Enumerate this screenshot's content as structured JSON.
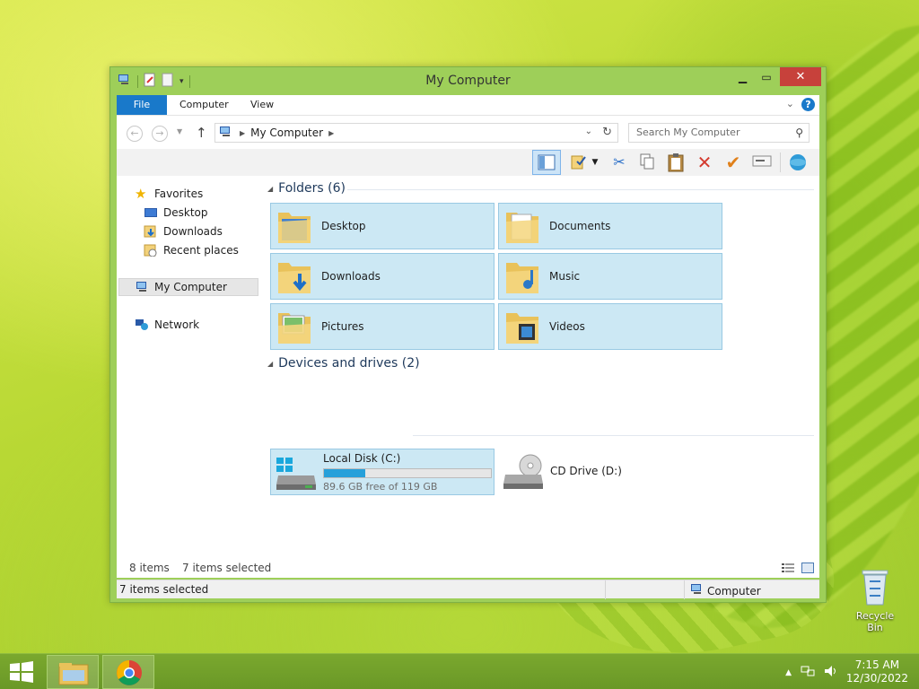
{
  "window": {
    "title": "My Computer"
  },
  "ribbon": {
    "tabs": [
      "File",
      "Computer",
      "View"
    ]
  },
  "address": {
    "crumb": "My Computer",
    "search_placeholder": "Search My Computer"
  },
  "nav_pane": {
    "favorites": "Favorites",
    "items": [
      "Desktop",
      "Downloads",
      "Recent places"
    ],
    "computer": "My Computer",
    "network": "Network"
  },
  "folders": {
    "header": "Folders (6)",
    "items": [
      "Desktop",
      "Documents",
      "Downloads",
      "Music",
      "Pictures",
      "Videos"
    ]
  },
  "drives": {
    "header": "Devices and drives (2)",
    "local": {
      "name": "Local Disk (C:)",
      "free_text": "89.6 GB free of 119 GB",
      "used_fraction": 0.247
    },
    "cd": {
      "name": "CD Drive (D:)"
    }
  },
  "status": {
    "count": "8 items",
    "selected": "7 items selected",
    "bar_left": "7 items selected",
    "bar_right": "Computer"
  },
  "desktop": {
    "recycle_bin": "Recycle Bin"
  },
  "taskbar": {
    "time": "7:15 AM",
    "date": "12/30/2022"
  },
  "colors": {
    "accent": "#1979ca",
    "window_frame": "#9ecf59",
    "tile_bg": "#cce8f4",
    "close": "#c7413b",
    "progress": "#26a0da"
  }
}
